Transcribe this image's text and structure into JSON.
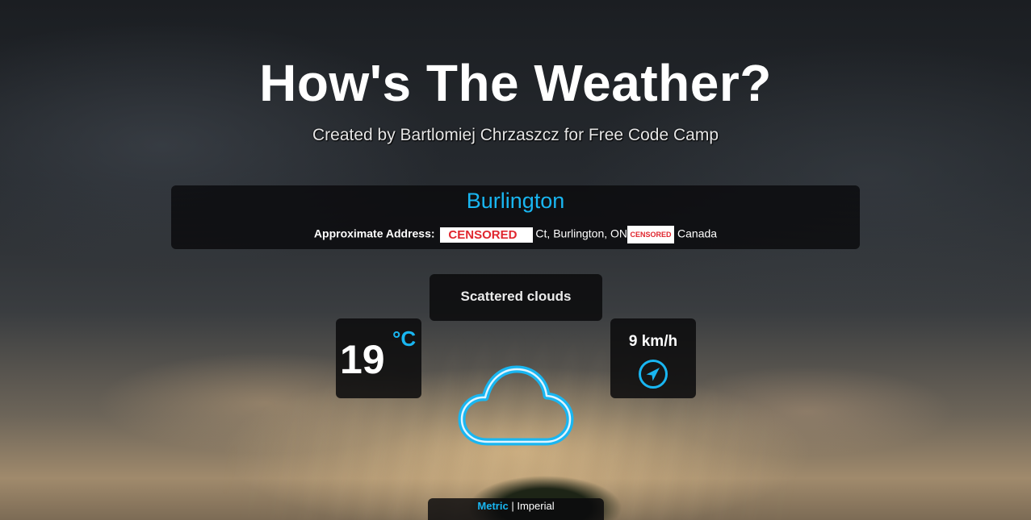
{
  "header": {
    "title": "How's The Weather?",
    "subtitle": "Created by Bartlomiej Chrzaszcz for Free Code Camp"
  },
  "location": {
    "city": "Burlington",
    "address_label": "Approximate Address:",
    "censored_street": "CENSORED",
    "address_mid": "Ct, Burlington, ON",
    "censored_postal": "CENSORED",
    "country": "Canada"
  },
  "weather": {
    "description": "Scattered clouds",
    "temperature": "19",
    "temperature_unit": "°C",
    "wind_speed": "9 km/h",
    "wind_icon": "navigation-arrow-icon",
    "condition_icon": "cloud-icon"
  },
  "units": {
    "metric_label": "Metric",
    "separator": "|",
    "imperial_label": "Imperial",
    "selected": "Metric"
  },
  "colors": {
    "accent": "#19b6f1",
    "censor_text": "#e0262e",
    "panel_bg": "rgba(10,10,12,0.85)"
  }
}
